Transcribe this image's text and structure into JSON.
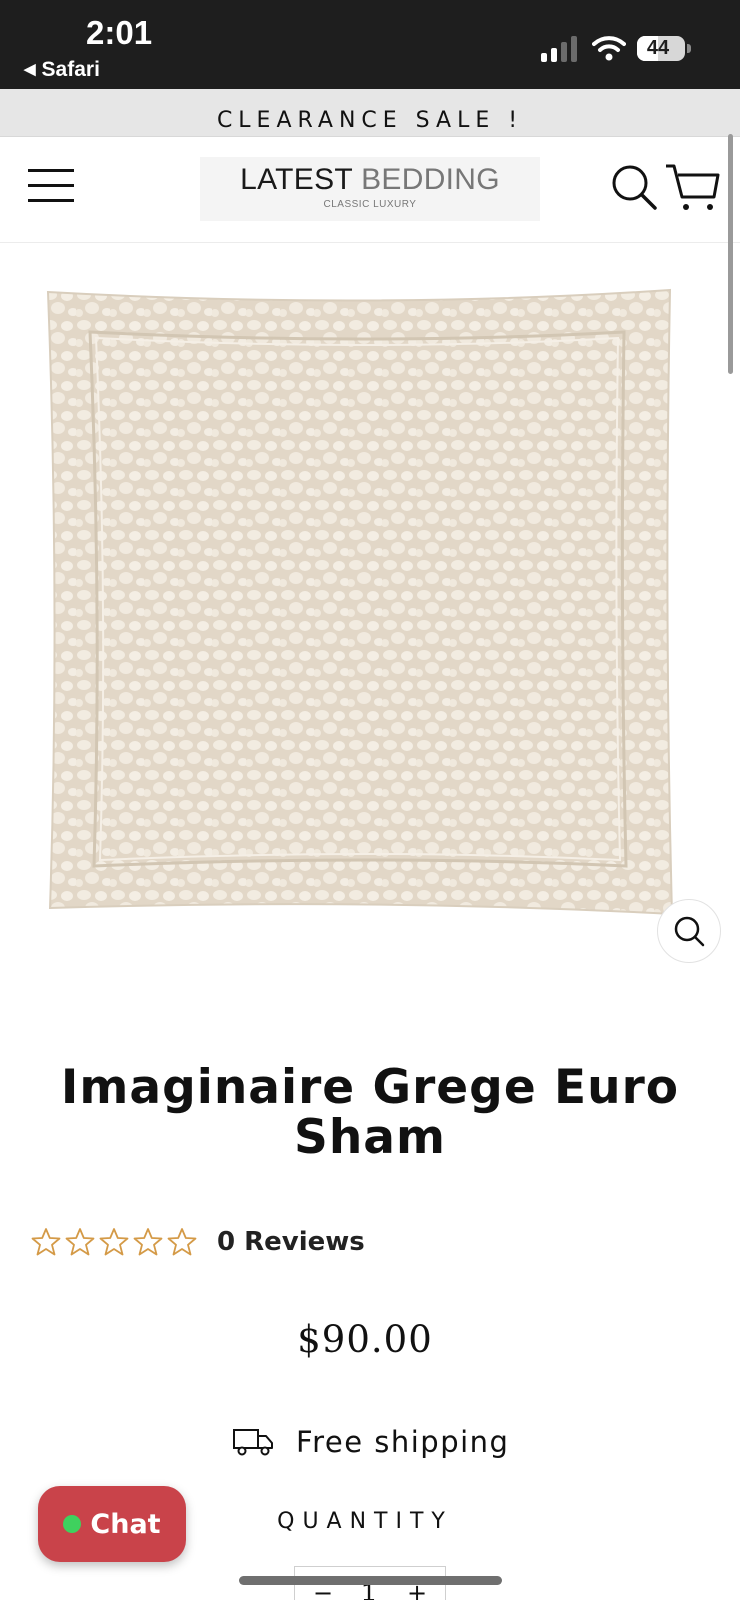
{
  "status_bar": {
    "time": "2:01",
    "back_label": "Safari",
    "battery_level": "44",
    "battery_fraction": 0.44
  },
  "announcement": {
    "text": "CLEARANCE SALE !"
  },
  "header": {
    "logo_main_dark": "LATEST",
    "logo_main_light": "BEDDING",
    "logo_tagline": "CLASSIC LUXURY",
    "icons": {
      "menu": "hamburger-menu-icon",
      "search": "search-icon",
      "cart": "cart-icon"
    }
  },
  "product": {
    "image_description_icon": "product-photo",
    "title": "Imaginaire Grege Euro Sham",
    "rating": {
      "stars_filled": 0,
      "stars_total": 5,
      "reviews_label": "0 Reviews"
    },
    "price": "$90.00",
    "shipping_label": "Free shipping",
    "quantity_label": "QUANTITY",
    "quantity": {
      "minus": "−",
      "value": "1",
      "plus": "+"
    }
  },
  "chat": {
    "label": "Chat",
    "status_color": "#3fd15e",
    "button_color": "#c9434a"
  },
  "colors": {
    "star_outline": "#d49a47",
    "fabric_base": "#e6dccd",
    "fabric_spots": "#f3ede2"
  }
}
